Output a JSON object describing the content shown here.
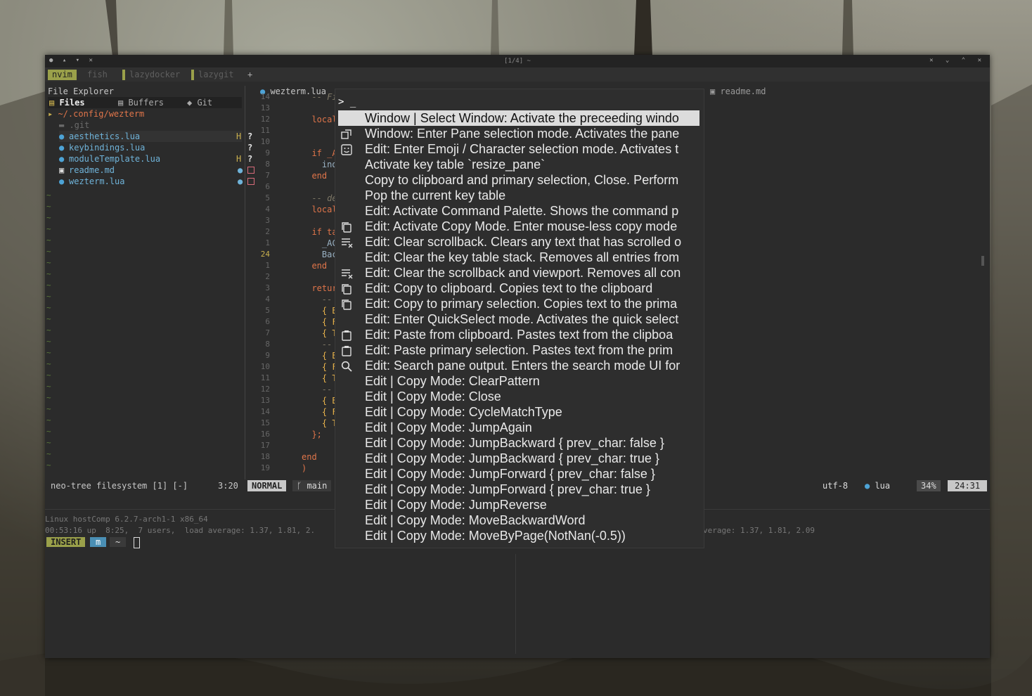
{
  "window": {
    "title": "[1/4] ~",
    "controls_left": "● ▴ ▾ ✕",
    "controls_right": "✕ ⌄ ⌃ ✕"
  },
  "tabs": [
    {
      "label": "nvim",
      "active": true
    },
    {
      "label": "fish",
      "active": false
    },
    {
      "label": "lazydocker",
      "active": false
    },
    {
      "label": "lazygit",
      "active": false
    },
    {
      "label": "+",
      "active": false
    }
  ],
  "explorer": {
    "title": "File Explorer",
    "tabs": [
      "Files",
      "Buffers",
      "Git"
    ],
    "root": "~/.config/wezterm",
    "entries": [
      {
        "name": ".git",
        "type": "folder",
        "flag": "",
        "status": ""
      },
      {
        "name": "aesthetics.lua",
        "type": "lua",
        "flag": "H",
        "status": "?"
      },
      {
        "name": "keybindings.lua",
        "type": "lua",
        "flag": "",
        "status": "?"
      },
      {
        "name": "moduleTemplate.lua",
        "type": "lua",
        "flag": "H",
        "status": "?"
      },
      {
        "name": "readme.md",
        "type": "md",
        "flag": "●",
        "status": "box"
      },
      {
        "name": "wezterm.lua",
        "type": "lua",
        "flag": "●",
        "status": "box"
      }
    ],
    "statusline": "neo-tree filesystem [1] [-]",
    "cursor": "3:20"
  },
  "editor": {
    "tab_active": "wezterm.lua",
    "tab_right": "readme.md",
    "line_numbers": [
      "14",
      "13",
      "12",
      "11",
      "10",
      "9",
      "8",
      "7",
      "6",
      "5",
      "4",
      "3",
      "2",
      "1",
      "24",
      "1",
      "2",
      "3",
      "4",
      "5",
      "6",
      "7",
      "8",
      "9",
      "10",
      "11",
      "12",
      "13",
      "14",
      "15",
      "16",
      "17",
      "18",
      "19"
    ],
    "code_lines": [
      "  -- Figu",
      "",
      "  local i",
      "",
      "",
      "  if _ACT",
      "    indic",
      "  end",
      "",
      "  -- defa",
      "  local B",
      "",
      "  if tab.",
      "    _ACTI",
      "    Backg",
      "  end",
      "",
      "  return",
      "    -- ::",
      "    { Bac",
      "    { For",
      "    { Tex",
      "    -- co",
      "    { Bac",
      "    { For",
      "    { Tex",
      "    -- ::",
      "    { Bac",
      "    { For",
      "    { Tex",
      "  };",
      "",
      "end",
      ")"
    ],
    "mode": "NORMAL",
    "branch": "main",
    "encoding": "utf-8",
    "filetype": "lua",
    "percent": "34%",
    "position": "24:31"
  },
  "terminal": {
    "left_lines": [
      "Linux hostComp 6.2.7-arch1-1 x86_64",
      "00:53:16 up  8:25,  7 users,  load average: 1.37, 1.81, 2."
    ],
    "right_line": "verage: 1.37, 1.81, 2.09",
    "prompt_mode": "INSERT",
    "prompt_user": "m",
    "prompt_dir": "~"
  },
  "palette": {
    "prompt": "> _",
    "items": [
      {
        "label": "Window | Select Window: Activate the preceeding windo",
        "icon": "",
        "selected": true
      },
      {
        "label": "Window: Enter Pane selection mode. Activates the pane",
        "icon": "pane-select-icon",
        "selected": false
      },
      {
        "label": "Edit: Enter Emoji / Character selection mode. Activates t",
        "icon": "emoji-icon",
        "selected": false
      },
      {
        "label": "Activate key table `resize_pane`",
        "icon": "",
        "selected": false
      },
      {
        "label": "Copy to clipboard and primary selection, Close. Perform",
        "icon": "",
        "selected": false
      },
      {
        "label": "Pop the current key table",
        "icon": "",
        "selected": false
      },
      {
        "label": "Edit: Activate Command Palette. Shows the command p",
        "icon": "",
        "selected": false
      },
      {
        "label": "Edit: Activate Copy Mode. Enter mouse-less copy mode",
        "icon": "copy-icon",
        "selected": false
      },
      {
        "label": "Edit: Clear scrollback. Clears any text that has scrolled o",
        "icon": "clear-list-icon",
        "selected": false
      },
      {
        "label": "Edit: Clear the key table stack. Removes all entries from",
        "icon": "",
        "selected": false
      },
      {
        "label": "Edit: Clear the scrollback and viewport. Removes all con",
        "icon": "clear-list-icon",
        "selected": false
      },
      {
        "label": "Edit: Copy to clipboard. Copies text to the clipboard",
        "icon": "copy-icon",
        "selected": false
      },
      {
        "label": "Edit: Copy to primary selection. Copies text to the prima",
        "icon": "copy-icon",
        "selected": false
      },
      {
        "label": "Edit: Enter QuickSelect mode. Activates the quick select",
        "icon": "",
        "selected": false
      },
      {
        "label": "Edit: Paste from clipboard. Pastes text from the clipboa",
        "icon": "clipboard-icon",
        "selected": false
      },
      {
        "label": "Edit: Paste primary selection. Pastes text from the prim",
        "icon": "clipboard-icon",
        "selected": false
      },
      {
        "label": "Edit: Search pane output. Enters the search mode UI for",
        "icon": "search-icon",
        "selected": false
      },
      {
        "label": "Edit | Copy Mode: ClearPattern",
        "icon": "",
        "selected": false
      },
      {
        "label": "Edit | Copy Mode: Close",
        "icon": "",
        "selected": false
      },
      {
        "label": "Edit | Copy Mode: CycleMatchType",
        "icon": "",
        "selected": false
      },
      {
        "label": "Edit | Copy Mode: JumpAgain",
        "icon": "",
        "selected": false
      },
      {
        "label": "Edit | Copy Mode: JumpBackward { prev_char: false }",
        "icon": "",
        "selected": false
      },
      {
        "label": "Edit | Copy Mode: JumpBackward { prev_char: true }",
        "icon": "",
        "selected": false
      },
      {
        "label": "Edit | Copy Mode: JumpForward { prev_char: false }",
        "icon": "",
        "selected": false
      },
      {
        "label": "Edit | Copy Mode: JumpForward { prev_char: true }",
        "icon": "",
        "selected": false
      },
      {
        "label": "Edit | Copy Mode: JumpReverse",
        "icon": "",
        "selected": false
      },
      {
        "label": "Edit | Copy Mode: MoveBackwardWord",
        "icon": "",
        "selected": false
      },
      {
        "label": "Edit | Copy Mode: MoveByPage(NotNan(-0.5))",
        "icon": "",
        "selected": false
      }
    ]
  }
}
